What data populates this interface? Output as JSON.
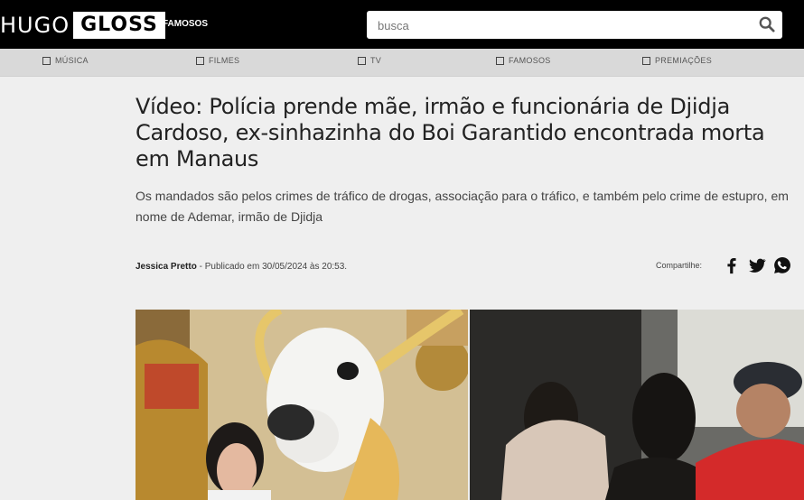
{
  "header": {
    "logo_left": "HUGO",
    "logo_right": "GLOSS",
    "nav_item": "FAMOSOS",
    "search_placeholder": "busca"
  },
  "categories": [
    {
      "label": "MÚSICA"
    },
    {
      "label": "FILMES"
    },
    {
      "label": "TV"
    },
    {
      "label": "FAMOSOS"
    },
    {
      "label": "PREMIAÇÕES"
    }
  ],
  "article": {
    "title": "Vídeo: Polícia prende mãe, irmão e funcionária de Djidja Cardoso, ex-sinhazinha do Boi Garantido encontrada morta em Manaus",
    "subtitle": "Os mandados são pelos crimes de tráfico de drogas, associação para o tráfico, e também pelo crime de estupro, em nome de Ademar, irmão de Djidja",
    "author": "Jessica Pretto",
    "published": "- Publicado em 30/05/2024 às 20:53."
  },
  "share": {
    "label": "Compartilhe:",
    "icons": [
      "facebook-icon",
      "twitter-icon",
      "whatsapp-icon"
    ]
  },
  "colors": {
    "topbar": "#000000",
    "catbar": "#d9d9d9",
    "page_bg": "#efefef",
    "title_text": "#222222"
  }
}
